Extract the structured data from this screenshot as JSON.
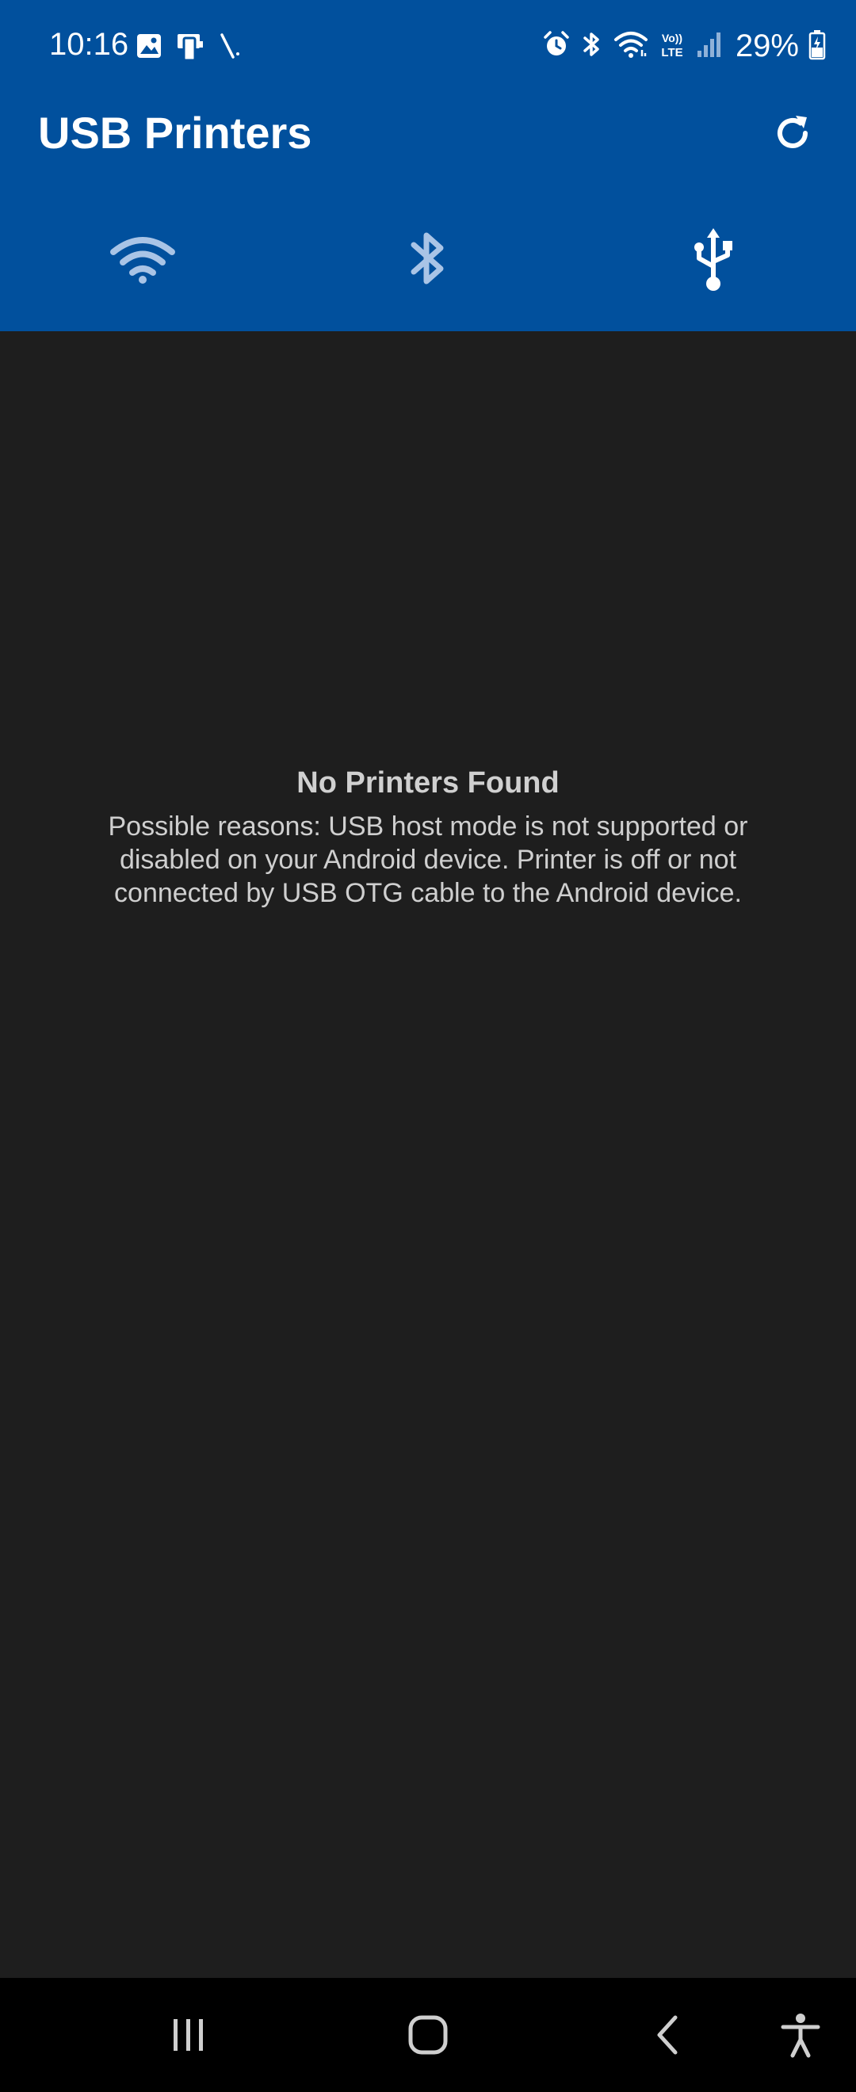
{
  "status_bar": {
    "time": "10:16",
    "battery": "29%",
    "left_icons": [
      "gallery-icon",
      "device-icon",
      "pen-icon"
    ],
    "right_icons": [
      "alarm-icon",
      "bluetooth-icon",
      "wifi-icon",
      "volte-icon",
      "signal-icon",
      "battery-icon"
    ]
  },
  "app_bar": {
    "title": "USB Printers",
    "refresh_icon": "refresh-icon",
    "background_color": "#01509d"
  },
  "tabs": [
    {
      "icon": "wifi-icon",
      "active": false
    },
    {
      "icon": "bluetooth-icon",
      "active": false
    },
    {
      "icon": "usb-icon",
      "active": true
    }
  ],
  "empty_state": {
    "title": "No Printers Found",
    "message": "Possible reasons: USB host mode is not supported or disabled on your Android device. Printer is off or not connected by USB OTG cable to the Android device."
  },
  "nav_bar": {
    "buttons": [
      "recents-icon",
      "home-icon",
      "back-icon",
      "accessibility-icon"
    ]
  }
}
